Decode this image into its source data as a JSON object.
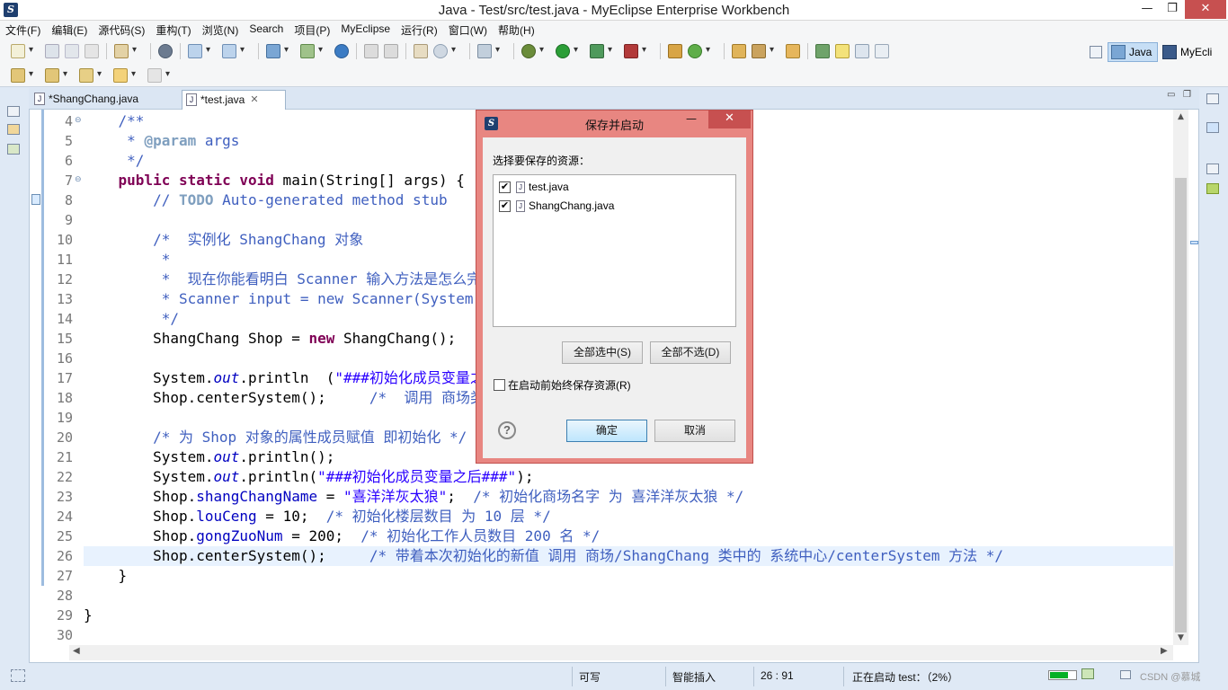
{
  "window": {
    "title": "Java  -  Test/src/test.java  -  MyEclipse Enterprise Workbench",
    "minimize": "—",
    "maximize": "❐",
    "close": "✕"
  },
  "menubar": [
    "文件(F)",
    "编辑(E)",
    "源代码(S)",
    "重构(T)",
    "浏览(N)",
    "Search",
    "项目(P)",
    "MyEclipse",
    "运行(R)",
    "窗口(W)",
    "帮助(H)"
  ],
  "perspectives": {
    "java": "Java",
    "myeclipse": "MyEcli"
  },
  "editor": {
    "tabs": [
      {
        "label": "*ShangChang.java"
      },
      {
        "label": "*test.java",
        "close": "✕"
      }
    ],
    "lines": [
      {
        "num": "4",
        "fold": "⊖"
      },
      {
        "num": "5"
      },
      {
        "num": "6"
      },
      {
        "num": "7",
        "fold": "⊖"
      },
      {
        "num": "8"
      },
      {
        "num": "9"
      },
      {
        "num": "10"
      },
      {
        "num": "11"
      },
      {
        "num": "12"
      },
      {
        "num": "13"
      },
      {
        "num": "14"
      },
      {
        "num": "15"
      },
      {
        "num": "16"
      },
      {
        "num": "17"
      },
      {
        "num": "18"
      },
      {
        "num": "19"
      },
      {
        "num": "20"
      },
      {
        "num": "21"
      },
      {
        "num": "22"
      },
      {
        "num": "23"
      },
      {
        "num": "24"
      },
      {
        "num": "25"
      },
      {
        "num": "26"
      },
      {
        "num": "27"
      },
      {
        "num": "28"
      },
      {
        "num": "29"
      },
      {
        "num": "30"
      }
    ],
    "code": {
      "l4": "    /**",
      "l5a": "     * ",
      "l5b": "@param",
      "l5c": " args",
      "l6": "     */",
      "l7a": "    ",
      "l7b": "public static void",
      "l7c": " main(String[] args) {",
      "l8a": "        // ",
      "l8b": "TODO",
      "l8c": " Auto-generated method stub",
      "l10": "        /*  实例化 ShangChang 对象",
      "l11": "         *",
      "l12": "         *  现在你能看明白 Scanner 输入方法是怎么完成的",
      "l13": "         * Scanner input = new Scanner(System",
      "l14": "         */",
      "l15a": "        ShangChang Shop = ",
      "l15b": "new",
      "l15c": " ShangChang();",
      "l17a": "        System.",
      "l17b": "out",
      "l17c": ".println  (",
      "l17d": "\"###初始化成员变量之",
      "l18a": "        Shop.centerSystem();     ",
      "l18b": "/*  调用 商场类 中的",
      "l20": "        /* 为 Shop 对象的属性成员赋值 即初始化 */",
      "l21a": "        System.",
      "l21b": "out",
      "l21c": ".println();",
      "l22a": "        System.",
      "l22b": "out",
      "l22c": ".println(",
      "l22d": "\"###初始化成员变量之后###\"",
      "l22e": ");",
      "l23a": "        Shop.",
      "l23b": "shangChangName",
      "l23c": " = ",
      "l23d": "\"喜洋洋灰太狼\"",
      "l23e": ";  ",
      "l23f": "/* 初始化商场名字 为 喜洋洋灰太狼 */",
      "l24a": "        Shop.",
      "l24b": "louCeng",
      "l24c": " = 10;  ",
      "l24d": "/* 初始化楼层数目 为 10 层 */",
      "l25a": "        Shop.",
      "l25b": "gongZuoNum",
      "l25c": " = 200;  ",
      "l25d": "/* 初始化工作人员数目 200 名 */",
      "l26a": "        Shop.centerSystem();     ",
      "l26b": "/* 带着本次初始化的新值 调用 商场/ShangChang 类中的 系统中心/centerSystem 方法 */",
      "l27": "    }",
      "l29": "}"
    }
  },
  "dialog": {
    "title": "保存并启动",
    "minimize": "—",
    "maximize": "☐",
    "close": "✕",
    "label": "选择要保存的资源：",
    "resources": [
      {
        "name": "test.java",
        "checked": true
      },
      {
        "name": "ShangChang.java",
        "checked": true
      }
    ],
    "check_mark": "✔",
    "select_all": "全部选中(S)",
    "deselect_all": "全部不选(D)",
    "always_save": "在启动前始终保存资源(R)",
    "help": "?",
    "ok": "确定",
    "cancel": "取消"
  },
  "status": {
    "writable": "可写",
    "insert_mode": "智能插入",
    "position": "26 : 91",
    "launch": "正在启动 test：（2%）",
    "progress": 0.7,
    "watermark": "CSDN @慕城"
  },
  "colors": {
    "dialog_frame": "#e88681",
    "progress_fill": "#06b025",
    "keyword": "#7f0055",
    "comment": "#3f5fbf",
    "string": "#2a00ff"
  }
}
